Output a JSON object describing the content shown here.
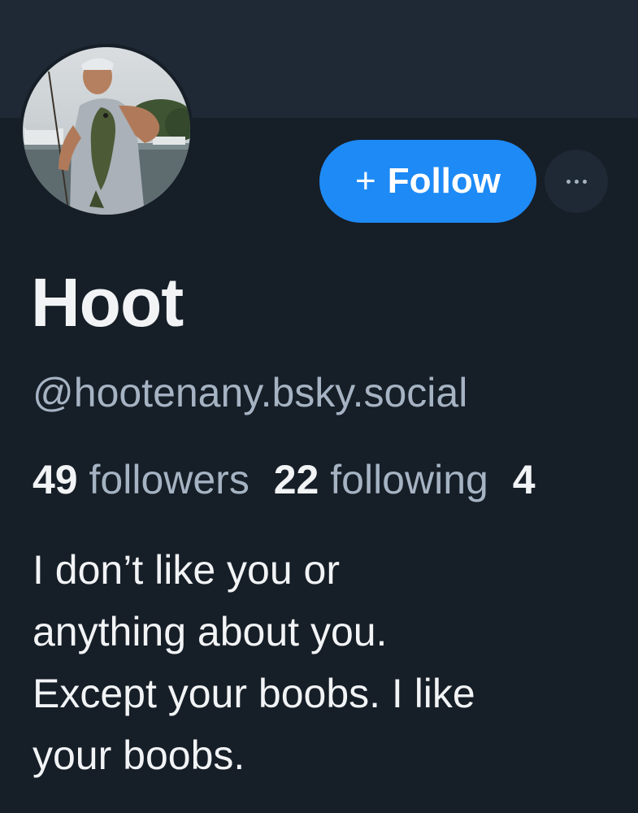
{
  "profile": {
    "display_name": "Hoot",
    "handle": "@hootenany.bsky.social",
    "bio": "I don’t like you or\nanything about you.\nExcept your boobs. I like\nyour boobs.",
    "avatar_icon": "profile-photo"
  },
  "actions": {
    "follow_plus": "+",
    "follow_label": "Follow",
    "more_icon": "ellipsis-icon"
  },
  "stats": {
    "followers_count": "49",
    "followers_label": "followers",
    "following_count": "22",
    "following_label": "following",
    "posts_count": "4"
  },
  "colors": {
    "background": "#161e27",
    "banner": "#1e2935",
    "accent": "#1e8af5",
    "primary_text": "#f1f3f5",
    "secondary_text": "#a5b3c3"
  }
}
